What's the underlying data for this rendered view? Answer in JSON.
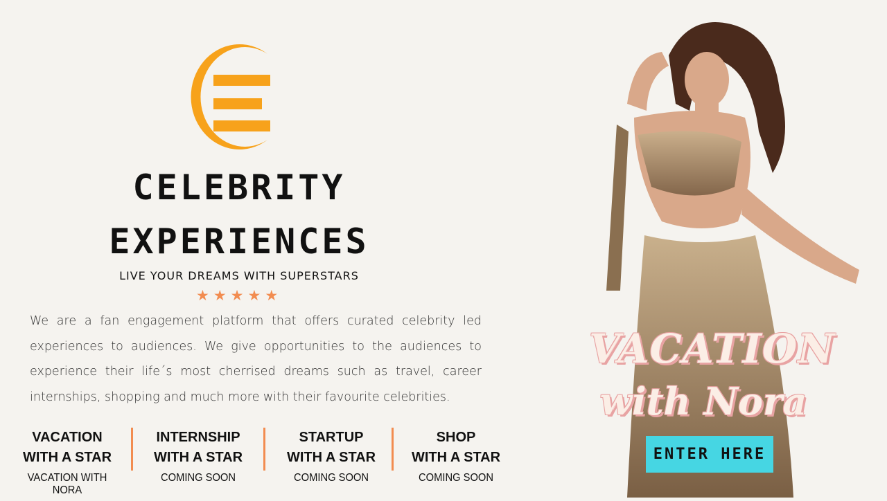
{
  "brand": {
    "title_line1": "CELEBRITY",
    "title_line2": "EXPERIENCES",
    "tagline": "LIVE YOUR DREAMS WITH SUPERSTARS",
    "rating_stars": 5,
    "accent_color": "#f7a21b",
    "star_color": "#f28c50"
  },
  "description": "We are a fan engagement platform that offers curated celebrity led experiences to audiences. We give opportunities to the audiences to experience their life´s most cherrised dreams such as travel, career internships, shopping and much more with their favourite celebrities.",
  "categories": [
    {
      "line1": "VACATION",
      "line2": "WITH A STAR",
      "status": "VACATION WITH NORA"
    },
    {
      "line1": "INTERNSHIP",
      "line2": "WITH A STAR",
      "status": "COMING SOON"
    },
    {
      "line1": "STARTUP",
      "line2": "WITH A STAR",
      "status": "COMING SOON"
    },
    {
      "line1": "SHOP",
      "line2": "WITH A STAR",
      "status": "COMING SOON"
    }
  ],
  "promo": {
    "line1": "VACATION",
    "line2": "with Nora",
    "cta_label": "ENTER HERE",
    "cta_color": "#46d6e3"
  }
}
